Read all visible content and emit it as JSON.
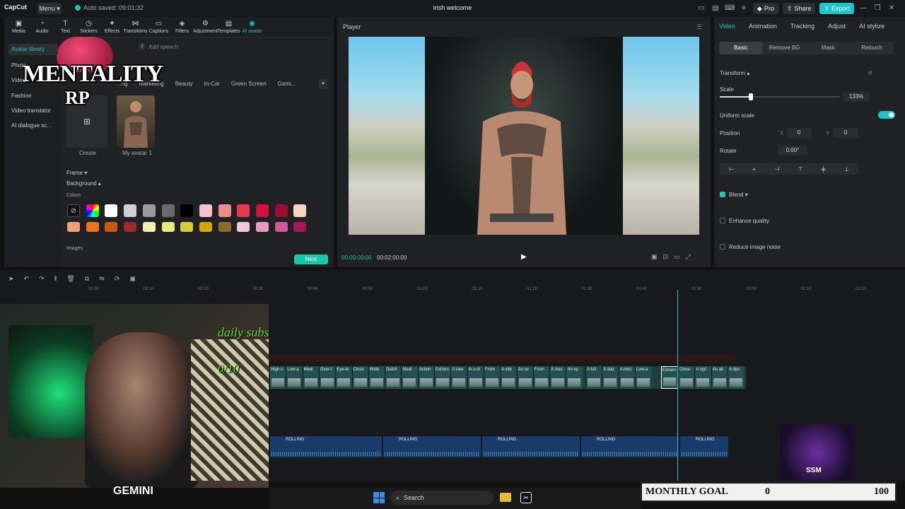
{
  "app": {
    "logo": "CapCut",
    "menu_label": "Menu",
    "autosave": "Auto saved: 09:01:32",
    "project_title": "irish welcome",
    "pro_label": "Pro",
    "share_label": "Share",
    "export_label": "Export"
  },
  "toolbar": {
    "tools": [
      "Media",
      "Audio",
      "Text",
      "Stickers",
      "Effects",
      "Transitions",
      "Captions",
      "Filters",
      "Adjustment",
      "Templates",
      "AI avatar"
    ],
    "active": "AI avatar"
  },
  "left_panel": {
    "nav": [
      "Avatar library",
      "Photo",
      "Video",
      "Fashion",
      "Video translator",
      "AI dialogue sc..."
    ],
    "add_speech": "Add speech",
    "add_speech_step": "2",
    "categories": [
      "...ng",
      "Marketing",
      "Beauty",
      "In-Car",
      "Green Screen",
      "Gami..."
    ],
    "create_label": "Create",
    "avatar_label": "My avatar 1",
    "frame_label": "Frame",
    "background_label": "Background",
    "colors_label": "Colors",
    "images_label": "Images",
    "next_label": "Next",
    "swatches_row1": [
      "none",
      "rainbow",
      "#ffffff",
      "#cfcfcf",
      "#9a9a9a",
      "#6b6b6b",
      "#000000",
      "#f7c0cc",
      "#f28a8a",
      "#e8384f",
      "#d1123f",
      "#9b0f2e",
      "#f7d2c0"
    ],
    "swatches_row2": [
      "#f0a07f",
      "#e8741c",
      "#c9580e",
      "#9c2a2a",
      "#f4f0b0",
      "#e7ea7a",
      "#d9cc3c",
      "#d1a60c",
      "#8c6b2a",
      "#f4c6d9",
      "#e99bc2",
      "#d0589a",
      "#a8155e"
    ]
  },
  "overlay": {
    "logo_line1": "MENTALITY",
    "logo_line2": "RP",
    "daily_subs": "daily subs",
    "subs_count": "0/10",
    "gemini": "GEMINI",
    "ssm": "SSM",
    "goal_label": "MONTHLY GOAL",
    "goal_current": "0",
    "goal_target": "100"
  },
  "player": {
    "title": "Player",
    "time_current": "00:00:00:00",
    "time_total": "00:02:00:00"
  },
  "right_panel": {
    "tabs": [
      "Video",
      "Animation",
      "Tracking",
      "Adjust",
      "AI stylize"
    ],
    "active_tab": "Video",
    "subtabs": [
      "Basic",
      "Remove BG",
      "Mask",
      "Retouch"
    ],
    "active_subtab": "Basic",
    "transform_label": "Transform",
    "scale_label": "Scale",
    "scale_value": "133%",
    "uniform_scale_label": "Uniform scale",
    "uniform_scale_on": true,
    "position_label": "Position",
    "pos_x_label": "X",
    "pos_x": "0",
    "pos_y_label": "Y",
    "pos_y": "0",
    "rotate_label": "Rotate",
    "rotate_value": "0.00°",
    "blend_label": "Blend",
    "enhance_label": "Enhance quality",
    "noise_label": "Reduce image noise"
  },
  "timeline": {
    "ruler": [
      "00:00",
      "00:10",
      "00:20",
      "00:30",
      "00:40",
      "00:50",
      "01:00",
      "01:10",
      "01:20",
      "01:30",
      "01:40",
      "01:50",
      "02:00",
      "02:10",
      "02:20"
    ],
    "clips": [
      "High-c",
      "Low-a",
      "Medi",
      "Over-t",
      "Eye-le",
      "Close",
      "Wide",
      "Dutch",
      "Medi",
      "Action",
      "Extrem",
      "A slee",
      "In a di",
      "From",
      "A vibr",
      "An ov",
      "From",
      "A mes",
      "An ey",
      "A full",
      "A stat",
      "A mini",
      "Low-a",
      "Extrem",
      "Close",
      "A styl",
      "An ab",
      "A dyn"
    ],
    "audio": [
      "ROLLING",
      "ROLLING",
      "ROLLING",
      "ROLLING",
      "ROLLING"
    ]
  },
  "taskbar": {
    "search_placeholder": "Search"
  }
}
